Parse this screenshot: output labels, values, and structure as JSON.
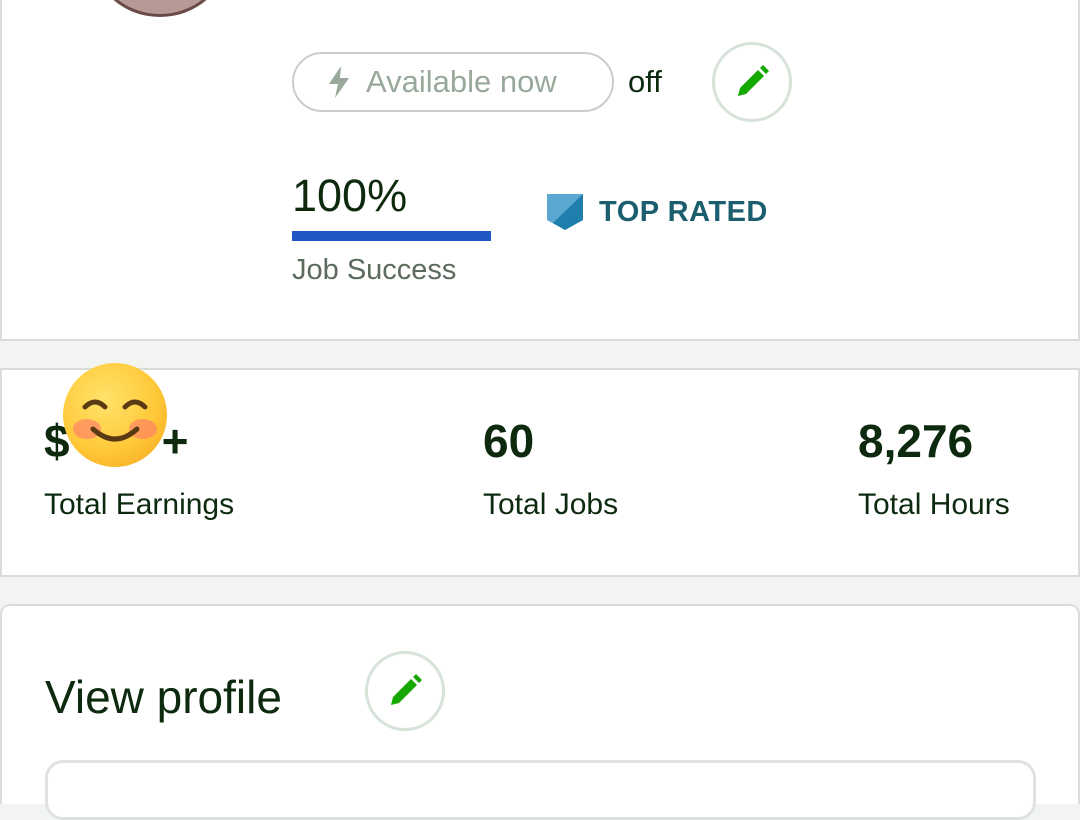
{
  "availability": {
    "pill_label": "Available now",
    "state": "off",
    "icon": "lightning-bolt-icon"
  },
  "job_success": {
    "value": "100%",
    "label": "Job Success",
    "progress_fraction": 1.0,
    "bar_color": "#1f57c3"
  },
  "badge": {
    "label": "TOP RATED",
    "icon": "top-rated-badge-icon",
    "color": "#1b5e6e"
  },
  "stats": [
    {
      "value": "$",
      "value_suffix": "+",
      "label": "Total Earnings"
    },
    {
      "value": "60",
      "label": "Total Jobs"
    },
    {
      "value": "8,276",
      "label": "Total Hours"
    }
  ],
  "overlay": {
    "icon": "smiling-face-emoji"
  },
  "profile": {
    "title": "View profile",
    "edit_icon": "pencil-icon"
  },
  "colors": {
    "accent_green": "#14a800",
    "text_dark": "#0d2a0f",
    "muted": "#98a89a"
  }
}
